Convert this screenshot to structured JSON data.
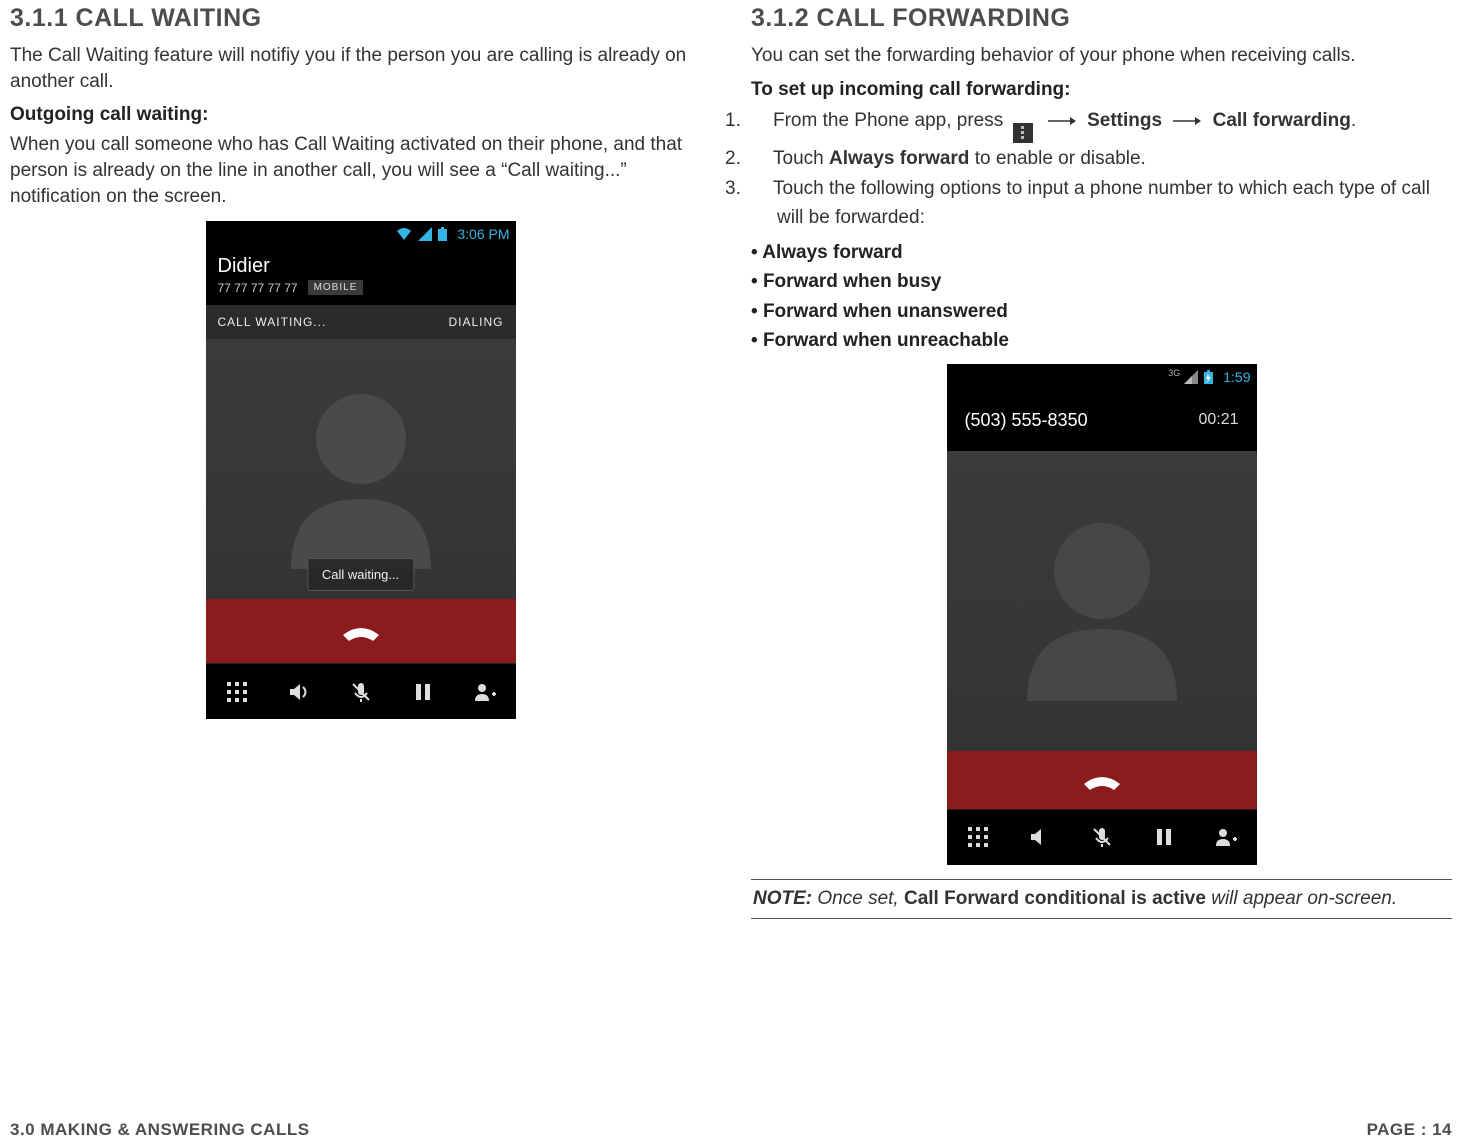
{
  "left": {
    "heading": "3.1.1 CALL WAITING",
    "intro": "The Call Waiting feature will notifiy you if the person you are calling is already on another call.",
    "subheading": "Outgoing call waiting:",
    "body": "When you call someone who has Call Waiting activated on their phone, and that person is already on the line in another call, you will see a “Call waiting...” notification on the screen.",
    "screenshot": {
      "status_time": "3:06 PM",
      "contact_name": "Didier",
      "contact_number": "77 77 77 77 77",
      "number_type": "MOBILE",
      "strip_left": "CALL WAITING...",
      "strip_right": "DIALING",
      "toast": "Call waiting..."
    }
  },
  "right": {
    "heading": "3.1.2 CALL FORWARDING",
    "intro": "You can set the forwarding behavior of your phone when receiving calls.",
    "subheading": "To set up incoming call forwarding:",
    "step1_prefix": "From the Phone app, press",
    "step1_link_settings": "Settings",
    "step1_link_cf": "Call forwarding",
    "step2_prefix": "Touch ",
    "step2_bold": "Always forward",
    "step2_suffix": " to enable or disable.",
    "step3": "Touch the following options to input a phone number to which each type of call will be forwarded:",
    "bullets": {
      "b1": "Always forward",
      "b2": "Forward when busy",
      "b3": "Forward when unanswered",
      "b4": "Forward when unreachable"
    },
    "screenshot": {
      "status_time": "1:59",
      "phone_number": "(503) 555-8350",
      "call_timer": "00:21",
      "net_label": "3G"
    },
    "note_prefix": "NOTE:",
    "note_italic_1": " Once set, ",
    "note_bold": "Call Forward conditional is active",
    "note_italic_2": " will appear on-screen."
  },
  "footer": {
    "left": "3.0 MAKING & ANSWERING CALLS",
    "right": "PAGE : 14"
  }
}
